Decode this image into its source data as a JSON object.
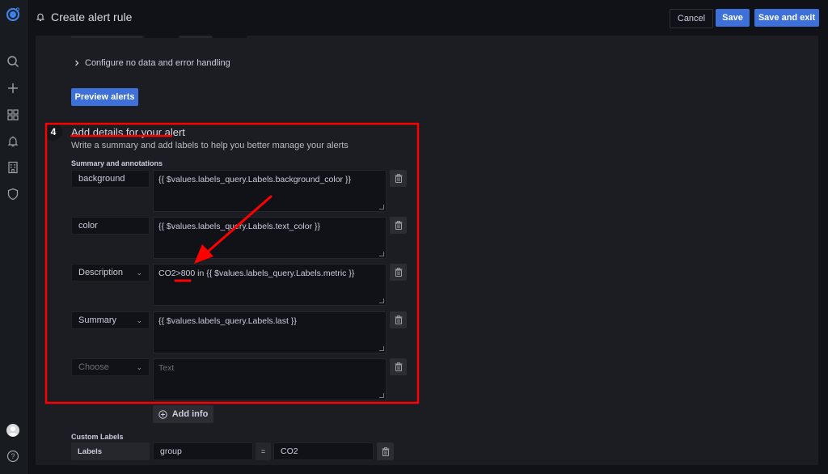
{
  "header": {
    "title": "Create alert rule",
    "cancel_label": "Cancel",
    "save_label": "Save",
    "save_exit_label": "Save and exit"
  },
  "sidebar": {
    "items": [
      {
        "icon": "search-icon"
      },
      {
        "icon": "plus-icon"
      },
      {
        "icon": "dashboards-icon"
      },
      {
        "icon": "bell-icon"
      },
      {
        "icon": "building-icon"
      },
      {
        "icon": "shield-icon"
      }
    ],
    "bottom": [
      {
        "icon": "user-avatar"
      },
      {
        "icon": "help-icon"
      }
    ]
  },
  "form": {
    "no_data_label": "Configure no data and error handling",
    "preview_label": "Preview alerts",
    "step": {
      "number": "4",
      "title": "Add details for your alert",
      "description": "Write a summary and add labels to help you better manage your alerts"
    },
    "annotations_label": "Summary and annotations",
    "annotations": [
      {
        "key": "background",
        "value": "{{ $values.labels_query.Labels.background_color }}",
        "select": false
      },
      {
        "key": "color",
        "value": "{{ $values.labels_query.Labels.text_color }}",
        "select": false
      },
      {
        "key": "Description",
        "value": "CO2>800 in {{ $values.labels_query.Labels.metric }}",
        "select": true
      },
      {
        "key": "Summary",
        "value": "{{ $values.labels_query.Labels.last }}",
        "select": true
      },
      {
        "key": "Choose",
        "value": "",
        "placeholder": "Text",
        "select": true,
        "key_placeholder": true
      }
    ],
    "add_info_label": "Add info",
    "custom_labels_label": "Custom Labels",
    "labels": {
      "prefix": "Labels",
      "key": "group",
      "operator": "=",
      "value": "CO2"
    }
  },
  "annotation_overlay": {
    "color": "#ff0000",
    "highlight": "Add details for your alert",
    "emphasized_value": "800"
  }
}
